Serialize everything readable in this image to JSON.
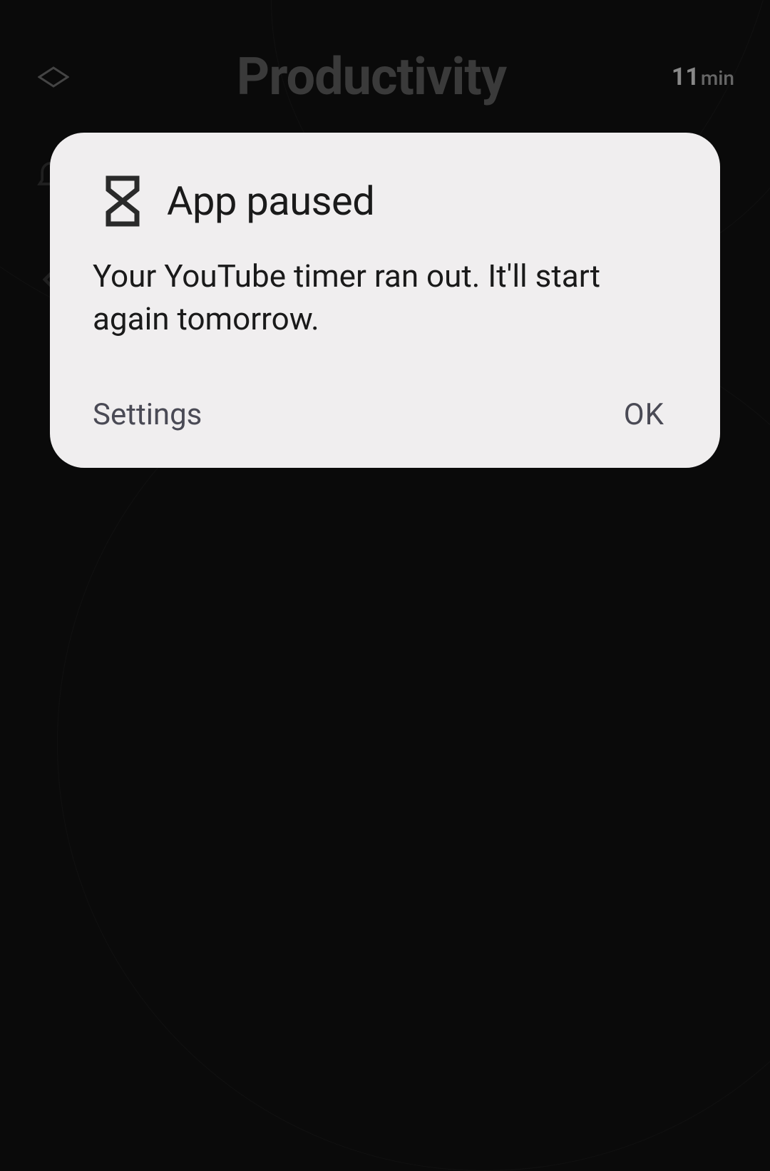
{
  "background": {
    "page_title": "Productivity",
    "timer": {
      "value": "11",
      "unit": "min"
    }
  },
  "dialog": {
    "title": "App paused",
    "message": "Your YouTube timer ran out. It'll start again tomorrow.",
    "settings_label": "Settings",
    "ok_label": "OK"
  },
  "icons": {
    "hourglass": "hourglass-icon",
    "diamond": "diamond-icon",
    "notification": "notification-icon",
    "chevron_left": "chevron-left-icon"
  }
}
